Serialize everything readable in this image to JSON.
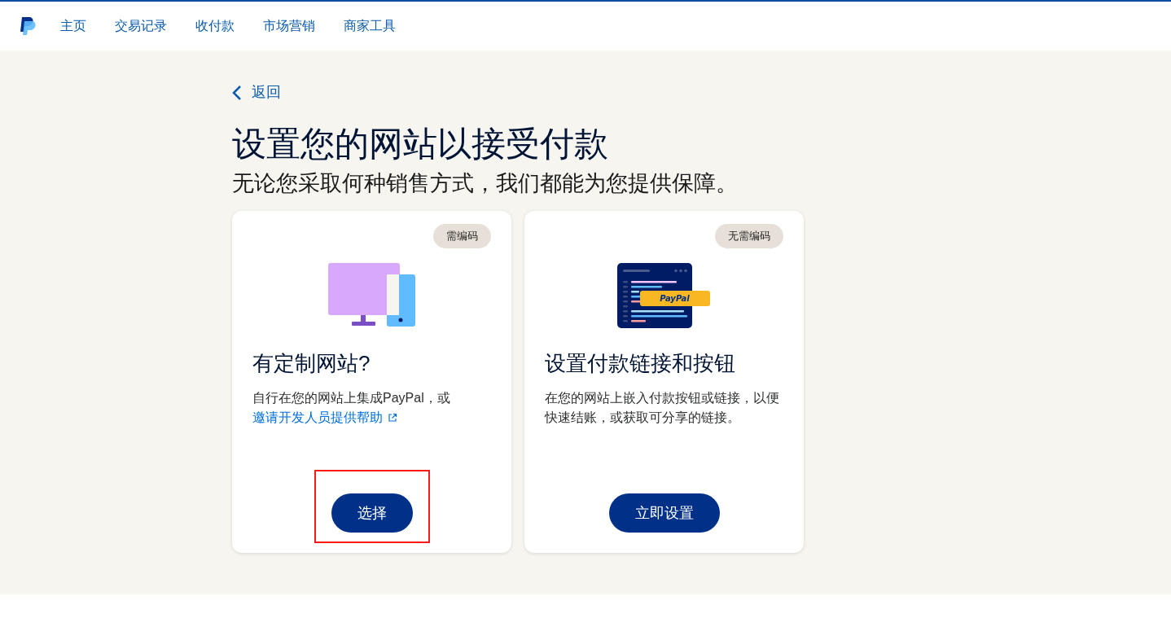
{
  "nav": {
    "items": [
      {
        "label": "主页"
      },
      {
        "label": "交易记录"
      },
      {
        "label": "收付款"
      },
      {
        "label": "市场营销"
      },
      {
        "label": "商家工具"
      }
    ]
  },
  "back": {
    "label": "返回"
  },
  "heading": "设置您的网站以接受付款",
  "subheading": "无论您采取何种销售方式，我们都能为您提供保障。",
  "cards": [
    {
      "kind": "devices",
      "badge": "需编码",
      "title": "有定制网站?",
      "description": "自行在您的网站上集成PayPal，或",
      "link": "邀请开发人员提供帮助",
      "button": "选择",
      "highlighted": true
    },
    {
      "kind": "code",
      "badge": "无需编码",
      "illustration_text": "PayPal",
      "title": "设置付款链接和按钮",
      "description": "在您的网站上嵌入付款按钮或链接，以便快速结账，或获取可分享的链接。",
      "button": "立即设置",
      "highlighted": false
    }
  ]
}
